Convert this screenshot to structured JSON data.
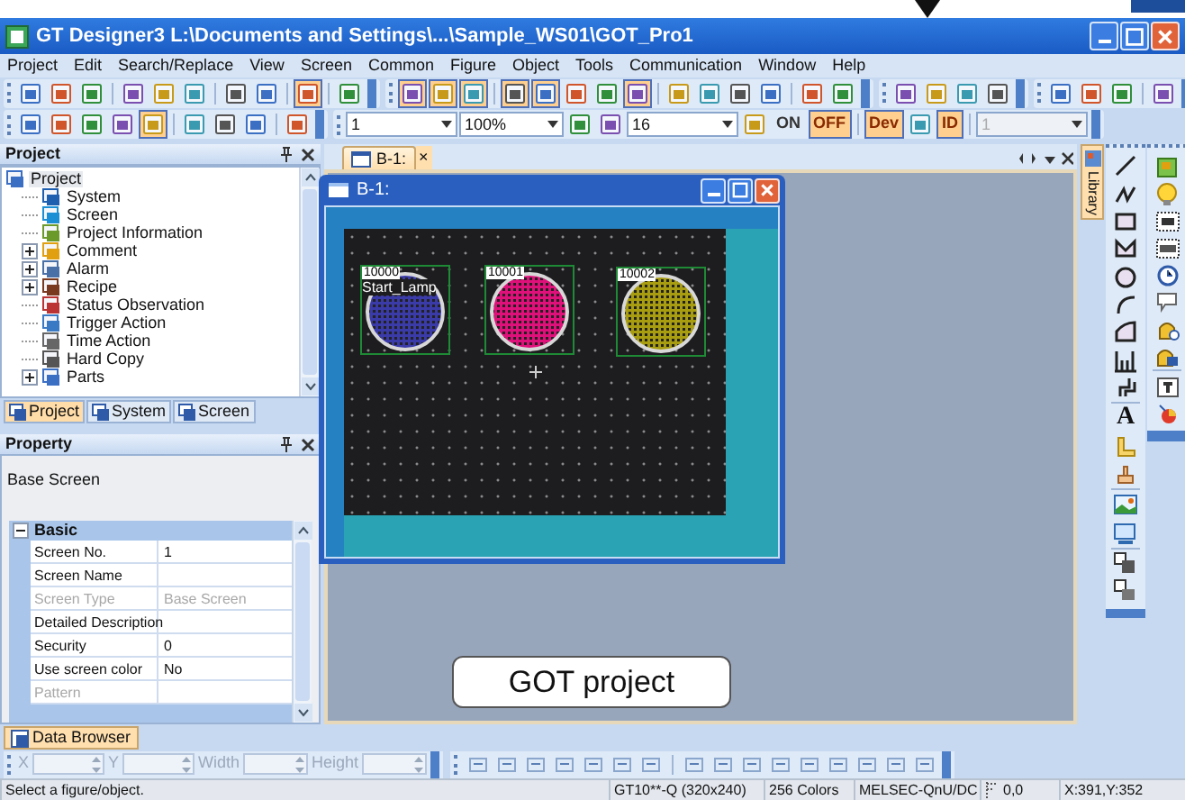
{
  "window": {
    "title": "GT Designer3 L:\\Documents and Settings\\...\\Sample_WS01\\GOT_Pro1"
  },
  "menu": [
    "Project",
    "Edit",
    "Search/Replace",
    "View",
    "Screen",
    "Common",
    "Figure",
    "Object",
    "Tools",
    "Communication",
    "Window",
    "Help"
  ],
  "toolbar_rows": [
    [
      {
        "kind": "grip"
      },
      {
        "kind": "button",
        "selected": false
      },
      {
        "kind": "button",
        "selected": false
      },
      {
        "kind": "button",
        "selected": false
      },
      {
        "kind": "separator"
      },
      {
        "kind": "button",
        "selected": false
      },
      {
        "kind": "button",
        "selected": false
      },
      {
        "kind": "button",
        "selected": false
      },
      {
        "kind": "separator"
      },
      {
        "kind": "button",
        "selected": false
      },
      {
        "kind": "button",
        "selected": false
      },
      {
        "kind": "separator"
      },
      {
        "kind": "button",
        "selected": true
      },
      {
        "kind": "separator"
      },
      {
        "kind": "button",
        "selected": false
      },
      {
        "kind": "end"
      },
      {
        "kind": "grip"
      },
      {
        "kind": "button",
        "selected": true
      },
      {
        "kind": "button",
        "selected": true
      },
      {
        "kind": "button",
        "selected": true
      },
      {
        "kind": "separator"
      },
      {
        "kind": "button",
        "selected": true
      },
      {
        "kind": "button",
        "selected": true
      },
      {
        "kind": "button",
        "selected": false
      },
      {
        "kind": "button",
        "selected": false
      },
      {
        "kind": "button",
        "selected": true
      },
      {
        "kind": "separator"
      },
      {
        "kind": "button",
        "selected": false
      },
      {
        "kind": "button",
        "selected": false
      },
      {
        "kind": "button",
        "selected": false
      },
      {
        "kind": "button",
        "selected": false
      },
      {
        "kind": "separator"
      },
      {
        "kind": "button",
        "selected": false
      },
      {
        "kind": "button",
        "selected": false
      },
      {
        "kind": "end"
      },
      {
        "kind": "grip"
      },
      {
        "kind": "button",
        "selected": false
      },
      {
        "kind": "button",
        "selected": false
      },
      {
        "kind": "button",
        "selected": false
      },
      {
        "kind": "button",
        "selected": false
      },
      {
        "kind": "end"
      },
      {
        "kind": "grip"
      },
      {
        "kind": "button",
        "selected": false
      },
      {
        "kind": "button",
        "selected": false
      },
      {
        "kind": "button",
        "selected": false
      },
      {
        "kind": "separator"
      },
      {
        "kind": "button",
        "selected": false
      },
      {
        "kind": "end"
      }
    ],
    [
      {
        "kind": "grip"
      },
      {
        "kind": "button",
        "selected": false
      },
      {
        "kind": "button",
        "selected": false
      },
      {
        "kind": "button",
        "selected": false
      },
      {
        "kind": "button",
        "selected": false
      },
      {
        "kind": "button",
        "selected": true
      },
      {
        "kind": "separator"
      },
      {
        "kind": "button",
        "selected": false
      },
      {
        "kind": "button",
        "selected": false
      },
      {
        "kind": "button",
        "selected": false
      },
      {
        "kind": "separator"
      },
      {
        "kind": "button",
        "selected": false
      },
      {
        "kind": "end"
      },
      {
        "kind": "grip"
      },
      {
        "kind": "dropdown",
        "value": "1",
        "disabled": false
      },
      {
        "kind": "dropdown",
        "value": "100%",
        "disabled": false
      },
      {
        "kind": "button",
        "selected": false
      },
      {
        "kind": "button",
        "selected": false
      },
      {
        "kind": "dropdown",
        "value": "16",
        "disabled": false
      },
      {
        "kind": "button",
        "selected": false
      },
      {
        "kind": "text",
        "label": "ON",
        "selected": false
      },
      {
        "kind": "text",
        "label": "OFF",
        "selected": true
      },
      {
        "kind": "separator"
      },
      {
        "kind": "text",
        "label": "Dev",
        "selected": true
      },
      {
        "kind": "button",
        "selected": false
      },
      {
        "kind": "text",
        "label": "ID",
        "selected": true
      },
      {
        "kind": "separator"
      },
      {
        "kind": "dropdown",
        "value": "1",
        "disabled": true
      },
      {
        "kind": "end"
      }
    ]
  ],
  "project_panel": {
    "title": "Project",
    "tree": [
      {
        "label": "Project",
        "selected": true,
        "children": [
          {
            "label": "System",
            "kind": "leaf",
            "selected": false
          },
          {
            "label": "Screen",
            "kind": "leaf",
            "selected": false
          },
          {
            "label": "Project Information",
            "kind": "leaf",
            "selected": false
          },
          {
            "label": "Comment",
            "kind": "group",
            "expanded": false,
            "selected": false
          },
          {
            "label": "Alarm",
            "kind": "group",
            "expanded": false,
            "selected": false
          },
          {
            "label": "Recipe",
            "kind": "group",
            "expanded": false,
            "selected": false
          },
          {
            "label": "Status Observation",
            "kind": "leaf",
            "selected": false
          },
          {
            "label": "Trigger Action",
            "kind": "leaf",
            "selected": false
          },
          {
            "label": "Time Action",
            "kind": "leaf",
            "selected": false
          },
          {
            "label": "Hard Copy",
            "kind": "leaf",
            "selected": false
          },
          {
            "label": "Parts",
            "kind": "group",
            "expanded": false,
            "selected": false
          }
        ]
      }
    ],
    "tabs": [
      {
        "label": "Project",
        "selected": true
      },
      {
        "label": "System",
        "selected": false
      },
      {
        "label": "Screen",
        "selected": false
      }
    ]
  },
  "property_panel": {
    "title": "Property",
    "description": "Base Screen",
    "category": "Basic",
    "category_expanded": true,
    "rows": [
      {
        "name": "Screen No.",
        "value": "1",
        "disabled": false
      },
      {
        "name": "Screen Name",
        "value": "",
        "disabled": false
      },
      {
        "name": "Screen Type",
        "value": "Base Screen",
        "disabled": true
      },
      {
        "name": "Detailed Description",
        "value": "",
        "disabled": false
      },
      {
        "name": "Security",
        "value": "0",
        "disabled": false
      },
      {
        "name": "Use screen color",
        "value": "No",
        "disabled": false
      },
      {
        "name": "Pattern",
        "value": "",
        "disabled": true
      }
    ]
  },
  "editor_tab": {
    "label": "B-1:",
    "close": "×"
  },
  "screen_window": {
    "title": "B-1:",
    "lamps": [
      {
        "device": "10000",
        "comment": "Start_Lamp",
        "color": "#3a3aa8"
      },
      {
        "device": "10001",
        "color": "#e0107a"
      },
      {
        "device": "10002",
        "color": "#a89c10"
      }
    ]
  },
  "callout": "GOT project",
  "library_tab": "Library",
  "figure_text_tool": "A",
  "data_browser_tab": "Data Browser",
  "coordinates": [
    {
      "label": "X"
    },
    {
      "label": "Y"
    },
    {
      "label": "Width"
    },
    {
      "label": "Height"
    }
  ],
  "status_bar": [
    "Select a figure/object.",
    "GT10**-Q (320x240)",
    "256 Colors",
    "MELSEC-QnU/DC",
    "0,0",
    "X:391,Y:352"
  ]
}
